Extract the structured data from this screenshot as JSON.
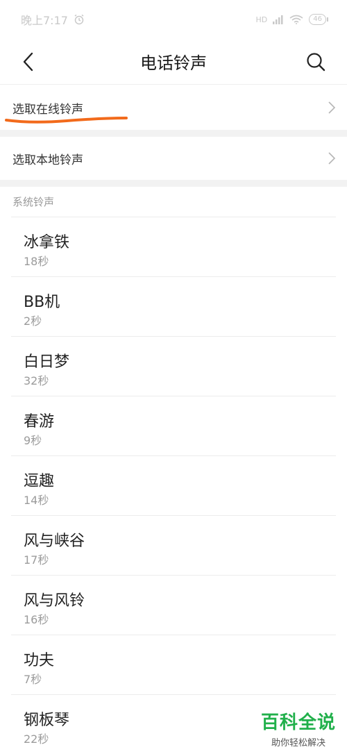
{
  "status": {
    "time": "晚上7:17",
    "network": "HD",
    "battery": "46"
  },
  "header": {
    "title": "电话铃声"
  },
  "rows": {
    "online": "选取在线铃声",
    "local": "选取本地铃声"
  },
  "section": {
    "label": "系统铃声"
  },
  "ringtones": [
    {
      "name": "冰拿铁",
      "duration": "18秒"
    },
    {
      "name": "BB机",
      "duration": "2秒"
    },
    {
      "name": "白日梦",
      "duration": "32秒"
    },
    {
      "name": "春游",
      "duration": "9秒"
    },
    {
      "name": "逗趣",
      "duration": "14秒"
    },
    {
      "name": "风与峡谷",
      "duration": "17秒"
    },
    {
      "name": "风与风铃",
      "duration": "16秒"
    },
    {
      "name": "功夫",
      "duration": "7秒"
    },
    {
      "name": "钢板琴",
      "duration": "22秒"
    }
  ],
  "watermark": {
    "title": "百科全说",
    "subtitle": "助你轻松解决"
  },
  "colors": {
    "underline": "#f26a1b",
    "watermark": "#21b04b"
  }
}
